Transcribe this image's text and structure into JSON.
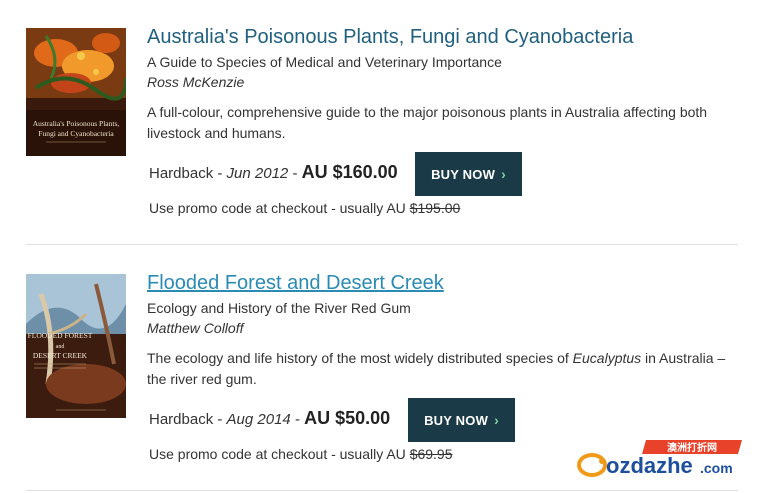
{
  "books": [
    {
      "title": "Australia's Poisonous Plants, Fungi and Cyanobacteria",
      "subtitle": "A Guide to Species of Medical and Veterinary Importance",
      "author": "Ross McKenzie",
      "description": "A full-colour, comprehensive guide to the major poisonous plants in Australia affecting both livestock and humans.",
      "format": "Hardback",
      "date": "Jun 2012",
      "price": "AU $160.00",
      "buy_label": "BUY NOW",
      "promo_text": "Use promo code at checkout - usually AU",
      "original_price": "$195.00",
      "cover_title": "Australia's Poisonous Plants, Fungi and Cyanobacteria"
    },
    {
      "title": "Flooded Forest and Desert Creek",
      "subtitle": "Ecology and History of the River Red Gum",
      "author": "Matthew Colloff",
      "description_before": "The ecology and life history of the most widely distributed species of ",
      "description_em": "Eucalyptus",
      "description_after": " in Australia – the river red gum.",
      "format": "Hardback",
      "date": "Aug 2014",
      "price": "AU $50.00",
      "buy_label": "BUY NOW",
      "promo_text": "Use promo code at checkout - usually AU",
      "original_price": "$69.95",
      "cover_title_1": "FLOODED FOREST",
      "cover_title_2": "DESERT CREEK"
    }
  ],
  "watermark": {
    "chinese": "澳洲打折网",
    "brand": "ozdazhe",
    "tld": ".com"
  },
  "colors": {
    "title": "#1f5f7f",
    "link": "#2a8bb4",
    "button": "#1a3a48",
    "chevron": "#7dd3a0"
  }
}
